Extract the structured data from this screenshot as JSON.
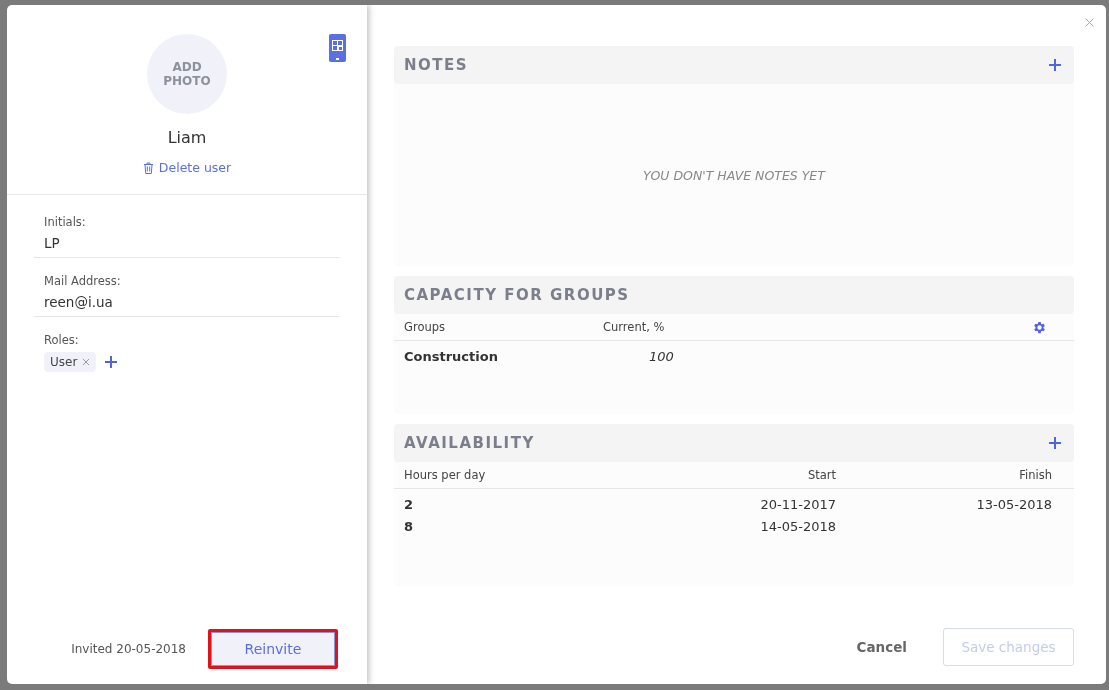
{
  "profile": {
    "photo_label": "ADD PHOTO",
    "name": "Liam",
    "delete_label": "Delete user"
  },
  "fields": [
    {
      "label": "Initials:",
      "value": "LP"
    },
    {
      "label": "Mail Address:",
      "value": "reen@i.ua"
    }
  ],
  "roles": {
    "label": "Roles:",
    "tags": [
      "User"
    ]
  },
  "invite": {
    "text": "Invited 20-05-2018",
    "button": "Reinvite",
    "highlighted": true
  },
  "notes": {
    "title": "NOTES",
    "empty_text": "YOU DON'T HAVE NOTES YET"
  },
  "capacity": {
    "title": "CAPACITY FOR GROUPS",
    "columns": [
      "Groups",
      "Current, %"
    ],
    "rows": [
      {
        "group": "Construction",
        "current": "100"
      }
    ]
  },
  "availability": {
    "title": "AVAILABILITY",
    "columns": [
      "Hours per day",
      "Start",
      "Finish"
    ],
    "rows": [
      {
        "hours": "2",
        "start": "20-11-2017",
        "finish": "13-05-2018"
      },
      {
        "hours": "8",
        "start": "14-05-2018",
        "finish": ""
      }
    ]
  },
  "footer": {
    "cancel": "Cancel",
    "save": {
      "label": "Save changes",
      "disabled": true
    }
  }
}
